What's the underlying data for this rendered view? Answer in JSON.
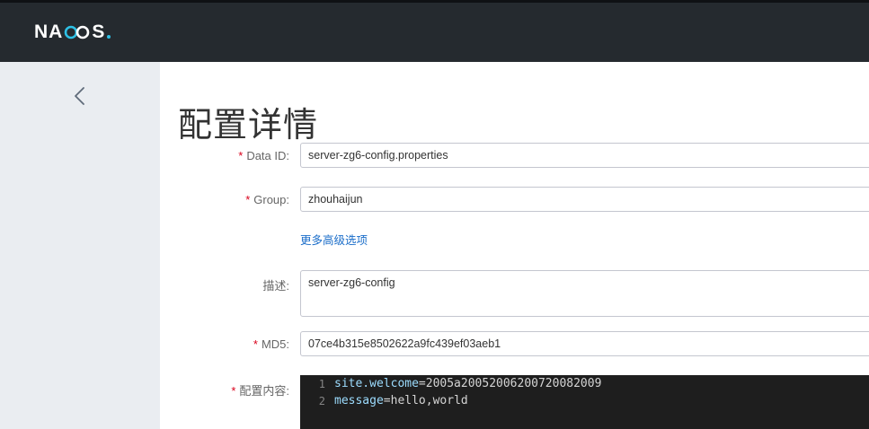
{
  "header": {
    "brand_left": "N",
    "brand_a": "A",
    "brand_right": "S",
    "brand_dot_color": "#2ec1e6",
    "logo_icon": "nacos-infinity-logo"
  },
  "sidebar": {
    "back_icon": "chevron-left-icon"
  },
  "page": {
    "title": "配置详情"
  },
  "form": {
    "data_id": {
      "label": "Data ID:",
      "value": "server-zg6-config.properties",
      "required": true
    },
    "group": {
      "label": "Group:",
      "value": "zhouhaijun",
      "required": true
    },
    "advanced_link": "更多高级选项",
    "description": {
      "label": "描述:",
      "value": "server-zg6-config",
      "required": false
    },
    "md5": {
      "label": "MD5:",
      "value": "07ce4b315e8502622a9fc439ef03aeb1",
      "required": true
    },
    "content": {
      "label": "配置内容:",
      "required": true,
      "lines": [
        {
          "num": "1",
          "key": "site.welcome",
          "eq": "=",
          "value": "2005a20052006200720082009"
        },
        {
          "num": "2",
          "key": "message",
          "eq": "=",
          "value": "hello,world"
        }
      ]
    },
    "required_mark": "*"
  },
  "colors": {
    "topbar": "#252a2f",
    "sidebar": "#eaedf1",
    "required": "#d9001b",
    "link": "#1a6dc9",
    "editor_bg": "#1e1e1e",
    "editor_key": "#9cdcfe"
  }
}
